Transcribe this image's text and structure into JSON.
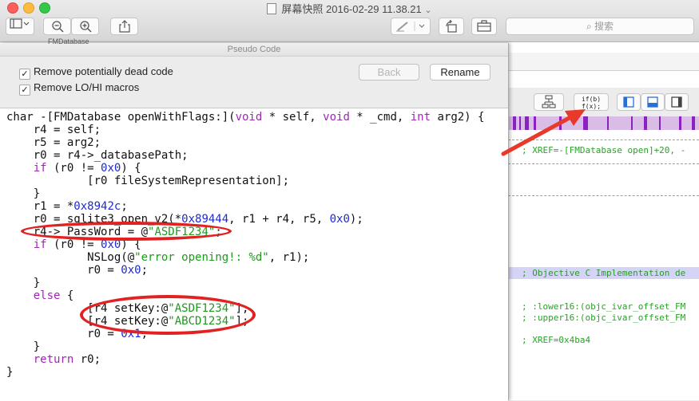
{
  "window": {
    "title": "屏幕快照 2016-02-29 11.38.21",
    "title_chevron": "⌄",
    "search_placeholder": "搜索"
  },
  "bg_window": {
    "tab_label": "FMDatabase",
    "mode_button": "if(b)\nf(x);",
    "asm_lines": [
      "; XREF=-[FMDatabase open]+20, -",
      "; Objective C Implementation de",
      "; :lower16:(objc_ivar_offset_FM",
      "; :upper16:(objc_ivar_offset_FM",
      "; XREF=0x4ba4"
    ]
  },
  "panel": {
    "title": "Pseudo Code",
    "option1": "Remove potentially dead code",
    "option2": "Remove LO/HI macros",
    "back_label": "Back",
    "rename_label": "Rename"
  },
  "code": {
    "l1": {
      "a": "char -[FMDatabase openWithFlags:](",
      "k1": "void",
      "b": " * self, ",
      "k2": "void",
      "c": " * _cmd, ",
      "k3": "int",
      "d": " arg2) {"
    },
    "l2": "    r4 = self;",
    "l3": "    r5 = arg2;",
    "l4": "    r0 = r4->_databasePath;",
    "l5": {
      "k": "if",
      "a": " (r0 != ",
      "n": "0x0",
      "b": ") {"
    },
    "l6": "            [r0 fileSystemRepresentation];",
    "l7": "    }",
    "l8": {
      "a": "    r1 = *",
      "n": "0x8942c",
      "b": ";"
    },
    "l9": {
      "a": "    r0 = sqlite3_open_v2(*",
      "n1": "0x89444",
      "b": ", r1 + r4, r5, ",
      "n2": "0x0",
      "c": ");"
    },
    "l10": {
      "a": "    r4->_PassWord = @",
      "s": "\"ASDF1234\"",
      "b": ";"
    },
    "l11": {
      "k": "if",
      "a": " (r0 != ",
      "n": "0x0",
      "b": ") {"
    },
    "l12": {
      "a": "            NSLog(@",
      "s": "\"error opening!: %d\"",
      "b": ", r1);"
    },
    "l13": {
      "a": "            r0 = ",
      "n": "0x0",
      "b": ";"
    },
    "l14": "    }",
    "l15": {
      "k": "else",
      "a": " {"
    },
    "l16": {
      "a": "            [r4 setKey:@",
      "s": "\"ASDF1234\"",
      "b": "];"
    },
    "l17": {
      "a": "            [r4 setKey:@",
      "s": "\"ABCD1234\"",
      "b": "];"
    },
    "l18": {
      "a": "            r0 = ",
      "n": "0x1",
      "b": ";"
    },
    "l19": "    }",
    "l20": {
      "k": "return",
      "a": " r0;"
    },
    "l21": "}"
  },
  "colors": {
    "keyword": "#a026b8",
    "number": "#1d2ad4",
    "string": "#1b9c1b",
    "annotation": "#e02222",
    "asm_comment": "#2aa12a"
  }
}
